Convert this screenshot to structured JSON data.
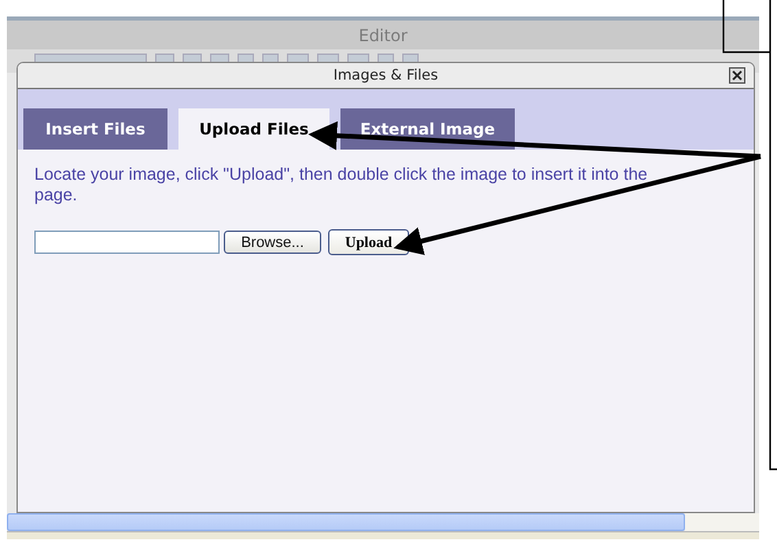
{
  "editor": {
    "title": "Editor"
  },
  "dialog": {
    "title": "Images & Files",
    "tabs": [
      {
        "label": "Insert Files",
        "selected": false
      },
      {
        "label": "Upload Files",
        "selected": true
      },
      {
        "label": "External Image",
        "selected": false
      }
    ],
    "instructions": "Locate your image, click \"Upload\", then double click the image to insert it into the page.",
    "browse_button": "Browse...",
    "upload_button": "Upload"
  }
}
